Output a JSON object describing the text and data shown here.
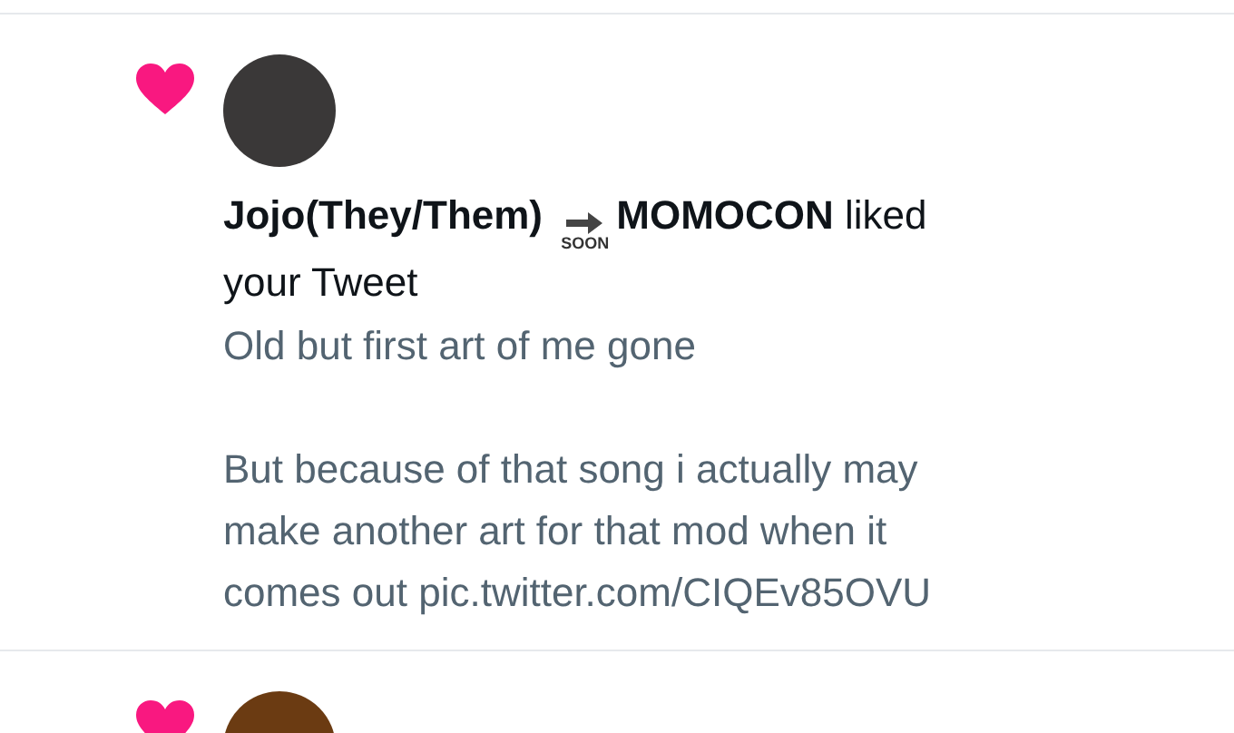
{
  "notifications": [
    {
      "kind": "like",
      "actor": "Jojo(They/Them)",
      "emoji_label": "SOON",
      "actor_after": "MOMOCON",
      "action": "liked your Tweet",
      "tweet_text": "Old but first art of me gone\n\nBut because of that song i actually may make another art for that mod when it comes out pic.twitter.com/CIQEv85OVU"
    },
    {
      "kind": "like"
    }
  ]
}
